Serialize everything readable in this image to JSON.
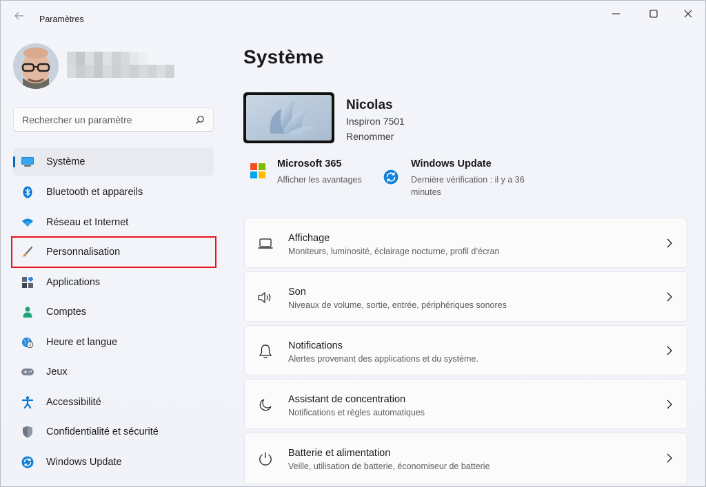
{
  "window": {
    "title": "Paramètres"
  },
  "search": {
    "placeholder": "Rechercher un paramètre"
  },
  "sidebar": {
    "items": [
      {
        "label": "Système",
        "icon": "display-icon"
      },
      {
        "label": "Bluetooth et appareils",
        "icon": "bluetooth-icon"
      },
      {
        "label": "Réseau et Internet",
        "icon": "wifi-icon"
      },
      {
        "label": "Personnalisation",
        "icon": "brush-icon"
      },
      {
        "label": "Applications",
        "icon": "apps-icon"
      },
      {
        "label": "Comptes",
        "icon": "person-icon"
      },
      {
        "label": "Heure et langue",
        "icon": "clock-globe-icon"
      },
      {
        "label": "Jeux",
        "icon": "gamepad-icon"
      },
      {
        "label": "Accessibilité",
        "icon": "accessibility-icon"
      },
      {
        "label": "Confidentialité et sécurité",
        "icon": "shield-icon"
      },
      {
        "label": "Windows Update",
        "icon": "update-icon"
      }
    ]
  },
  "main": {
    "title": "Système",
    "device": {
      "name": "Nicolas",
      "model": "Inspiron 7501",
      "rename": "Renommer"
    },
    "promos": [
      {
        "title": "Microsoft 365",
        "subtitle": "Afficher les avantages",
        "icon": "microsoft-logo-icon"
      },
      {
        "title": "Windows Update",
        "subtitle": "Dernière vérification : il y a 36 minutes",
        "icon": "update-icon"
      }
    ],
    "cards": [
      {
        "title": "Affichage",
        "subtitle": "Moniteurs, luminosité, éclairage nocturne, profil d’écran",
        "icon": "laptop-icon"
      },
      {
        "title": "Son",
        "subtitle": "Niveaux de volume, sortie, entrée, périphériques sonores",
        "icon": "speaker-icon"
      },
      {
        "title": "Notifications",
        "subtitle": "Alertes provenant des applications et du système.",
        "icon": "bell-icon"
      },
      {
        "title": "Assistant de concentration",
        "subtitle": "Notifications et règles automatiques",
        "icon": "moon-icon"
      },
      {
        "title": "Batterie et alimentation",
        "subtitle": "Veille, utilisation de batterie, économiseur de batterie",
        "icon": "power-icon"
      }
    ]
  },
  "colors": {
    "accent": "#0067c0",
    "highlight": "#e4161c",
    "background": "#f1f3f9"
  }
}
